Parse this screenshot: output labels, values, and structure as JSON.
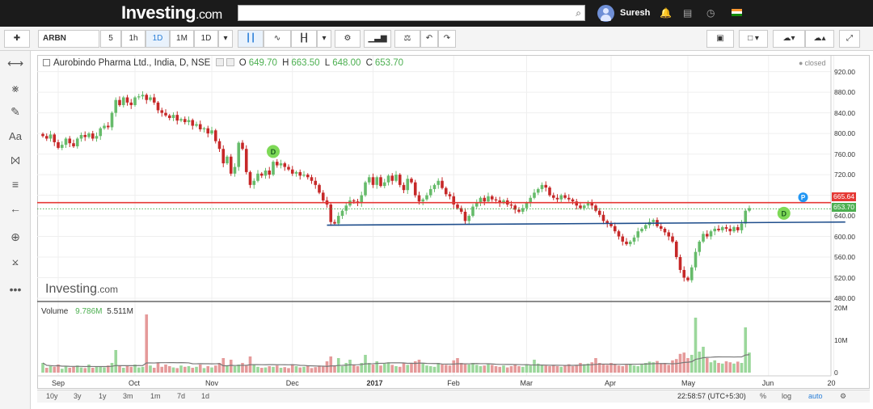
{
  "topbar": {
    "logo_main": "Investing",
    "logo_suffix": ".com",
    "user_name": "Suresh"
  },
  "toolbar": {
    "symbol": "ARBN",
    "intervals": [
      "5",
      "1h",
      "1D",
      "1M",
      "1D"
    ],
    "active_interval": "1D"
  },
  "legend": {
    "title": "Aurobindo Pharma Ltd., India, D, NSE",
    "open_label": "O",
    "open": "649.70",
    "high_label": "H",
    "high": "663.50",
    "low_label": "L",
    "low": "648.00",
    "close_label": "C",
    "close": "653.70",
    "status": "closed"
  },
  "volume_legend": {
    "label": "Volume",
    "v1": "9.786M",
    "v2": "5.511M"
  },
  "watermark": {
    "main": "Investing",
    "suffix": ".com"
  },
  "price_tags": {
    "resistance": "665.64",
    "last": "653.70"
  },
  "markers": {
    "dividend": "D",
    "pivot": "P"
  },
  "bottom": {
    "ranges": [
      "10y",
      "3y",
      "1y",
      "3m",
      "1m",
      "7d",
      "1d"
    ],
    "clock": "22:58:57 (UTC+5:30)",
    "percent": "%",
    "log": "log",
    "auto": "auto"
  },
  "colors": {
    "up": "#66bb6a",
    "down": "#c62828",
    "resistance": "#e53935",
    "support": "#1f4e8c",
    "last": "#4caf50"
  },
  "chart_data": {
    "type": "candlestick",
    "title": "Aurobindo Pharma Ltd., India, D, NSE",
    "y_ticks": [
      920,
      880,
      840,
      800,
      760,
      720,
      680,
      640,
      600,
      560,
      520,
      480
    ],
    "y_tick_labels": [
      "920.00",
      "880.00",
      "840.00",
      "800.00",
      "760.00",
      "720.00",
      "680.00",
      "640.00",
      "600.00",
      "560.00",
      "520.00",
      "480.00"
    ],
    "ylim": [
      480,
      932
    ],
    "x_labels": [
      "Sep",
      "Oct",
      "Nov",
      "Dec",
      "2017",
      "Feb",
      "Mar",
      "Apr",
      "May",
      "Jun",
      "20"
    ],
    "x_label_index": [
      4,
      24,
      44,
      65,
      86,
      107,
      126,
      148,
      168,
      189,
      206
    ],
    "volume_ticks": [
      "20M",
      "10M",
      "0"
    ],
    "volume_ylim": [
      0,
      20
    ],
    "resistance_level": 665.64,
    "support_line": {
      "from_index": 74,
      "from_value": 622,
      "to_index": 209,
      "to_value": 628
    },
    "series": [
      {
        "name": "Price",
        "close": [
          795,
          790,
          798,
          783,
          772,
          778,
          790,
          781,
          775,
          790,
          797,
          793,
          800,
          790,
          795,
          810,
          815,
          812,
          840,
          865,
          855,
          870,
          860,
          855,
          870,
          872,
          875,
          865,
          870,
          860,
          845,
          840,
          835,
          830,
          836,
          825,
          828,
          822,
          826,
          815,
          818,
          808,
          810,
          800,
          806,
          785,
          770,
          742,
          755,
          722,
          735,
          782,
          770,
          725,
          700,
          708,
          722,
          718,
          728,
          720,
          745,
          738,
          742,
          735,
          730,
          722,
          725,
          718,
          720,
          715,
          708,
          700,
          685,
          670,
          662,
          628,
          625,
          640,
          650,
          660,
          670,
          668,
          665,
          680,
          705,
          715,
          700,
          715,
          698,
          705,
          718,
          708,
          720,
          700,
          690,
          712,
          705,
          680,
          668,
          672,
          680,
          692,
          700,
          708,
          694,
          682,
          678,
          662,
          655,
          648,
          630,
          640,
          658,
          665,
          675,
          668,
          678,
          672,
          670,
          665,
          670,
          662,
          660,
          652,
          648,
          655,
          665,
          675,
          685,
          692,
          700,
          695,
          680,
          675,
          672,
          680,
          675,
          672,
          668,
          660,
          655,
          660,
          665,
          660,
          650,
          642,
          630,
          625,
          620,
          610,
          600,
          590,
          585,
          590,
          598,
          610,
          615,
          622,
          628,
          632,
          620,
          615,
          608,
          600,
          590,
          560,
          535,
          520,
          515,
          540,
          570,
          590,
          605,
          600,
          610,
          615,
          612,
          618,
          615,
          610,
          618,
          612,
          625,
          650,
          655
        ]
      },
      {
        "name": "Volume",
        "values": [
          3,
          1.5,
          2,
          1.8,
          2.5,
          1.2,
          2,
          1.5,
          1.8,
          2.2,
          1.6,
          1.4,
          2.5,
          1.5,
          1.8,
          2,
          1.6,
          2.2,
          3,
          7,
          2,
          1.5,
          2.2,
          1.8,
          2.5,
          1.6,
          1.8,
          18,
          2.2,
          1.5,
          3,
          1.8,
          2.5,
          2,
          1.6,
          1.4,
          2.2,
          1.8,
          2,
          1.5,
          1.8,
          2.5,
          1.4,
          2,
          1.6,
          2.2,
          3,
          4.5,
          2.2,
          4,
          2,
          2.5,
          3,
          2.2,
          5,
          2.4,
          1.8,
          1.5,
          1.6,
          2,
          1.8,
          2.2,
          1.5,
          1.7,
          1.4,
          2.6,
          2,
          1.6,
          1.8,
          2,
          1.4,
          1.7,
          2.2,
          2,
          3.5,
          5,
          2.2,
          4.5,
          2,
          3,
          4,
          2.4,
          2,
          3,
          5.5,
          3,
          2.5,
          3.5,
          2.2,
          2.8,
          3.2,
          2.4,
          2,
          1.8,
          3,
          2.4,
          2.8,
          3.5,
          4,
          2.8,
          2.2,
          2,
          1.8,
          3,
          2.5,
          2.4,
          2.2,
          3.8,
          4.5,
          3,
          2.6,
          2.5,
          3,
          2.4,
          2,
          2.2,
          2.6,
          2.4,
          2,
          1.8,
          2.2,
          1.6,
          2,
          2.4,
          2,
          1.8,
          2.6,
          2.2,
          4,
          2.8,
          2.4,
          2.2,
          2,
          2.4,
          2,
          1.8,
          2.2,
          2.6,
          2,
          2.4,
          3,
          2.6,
          2.8,
          3.2,
          4.5,
          3,
          2.6,
          2.4,
          3,
          2.6,
          2.2,
          2,
          2.4,
          2.6,
          2.2,
          2,
          2.6,
          3,
          3.4,
          3.2,
          3.6,
          2.8,
          3,
          2.4,
          3.8,
          4.2,
          5.8,
          6.2,
          4.5,
          5.5,
          17,
          6.5,
          8,
          4.5,
          3.2,
          3.8,
          3,
          2.8,
          3.5,
          3.2,
          2.8,
          3.4,
          3,
          14,
          6.2
        ]
      }
    ]
  }
}
